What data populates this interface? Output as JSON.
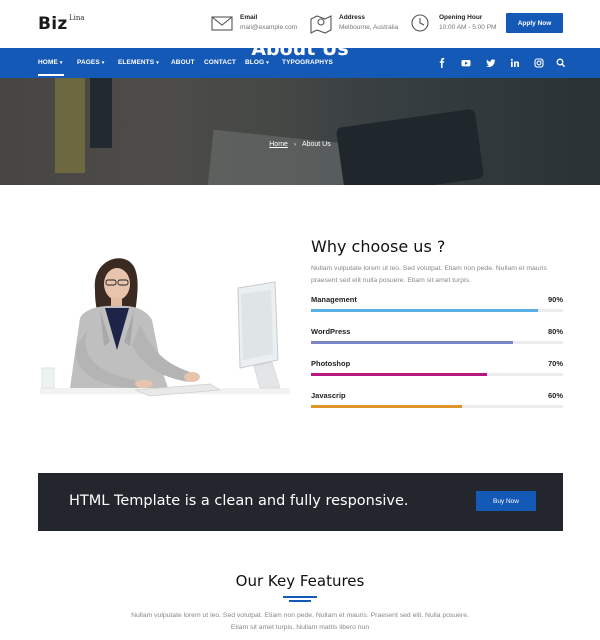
{
  "logo": {
    "text": "Biz",
    "sup": "Lina"
  },
  "header_info": [
    {
      "title": "Email",
      "value": "mail@example.com",
      "icon": "envelope-icon"
    },
    {
      "title": "Address",
      "value": "Melbourne, Australia",
      "icon": "map-icon"
    },
    {
      "title": "Opening Hour",
      "value": "10:00 AM - 5:00 PM",
      "icon": "clock-icon"
    }
  ],
  "apply_label": "Apply Now",
  "nav": {
    "items": [
      {
        "label": "HOME",
        "dropdown": true
      },
      {
        "label": "PAGES",
        "dropdown": true
      },
      {
        "label": "ELEMENTS",
        "dropdown": true
      },
      {
        "label": "ABOUT",
        "dropdown": false
      },
      {
        "label": "CONTACT",
        "dropdown": false
      },
      {
        "label": "BLOG",
        "dropdown": true
      },
      {
        "label": "TYPOGRAPHYS",
        "dropdown": false
      }
    ],
    "social": [
      "facebook-icon",
      "youtube-icon",
      "twitter-icon",
      "linkedin-icon",
      "instagram-icon",
      "search-icon"
    ]
  },
  "banner": {
    "title": "About Us",
    "crumb_home": "Home",
    "crumb_sep": "›",
    "crumb_current": "About Us"
  },
  "why": {
    "title": "Why choose us ?",
    "text": "Nullam vulputate lorem ut leo. Sed volutpat. Etiam non pede. Nullam et mauris praesent sed elit nulla posuere. Etiam sit amet turpis.",
    "skills": [
      {
        "label": "Management",
        "percent_text": "90%",
        "percent": 90,
        "color": "#5aaee6"
      },
      {
        "label": "WordPress",
        "percent_text": "80%",
        "percent": 80,
        "color": "#7d86c4"
      },
      {
        "label": "Photoshop",
        "percent_text": "70%",
        "percent": 70,
        "color": "#b6187f"
      },
      {
        "label": "Javascrip",
        "percent_text": "60%",
        "percent": 60,
        "color": "#e0952a"
      }
    ]
  },
  "cta": {
    "text": "HTML Template is a clean and fully responsive.",
    "button": "Buy Now"
  },
  "features": {
    "title": "Our Key Features",
    "text": "Nullam vulputate lorem ut leo. Sed volutpat. Etiam non pede. Nullam et mauris. Praesent sed elit. Nulla posuere. Etiam sit amet turpis. Nullam mattis libero non"
  },
  "colors": {
    "primary": "#1459b5",
    "dark": "#24262e"
  }
}
